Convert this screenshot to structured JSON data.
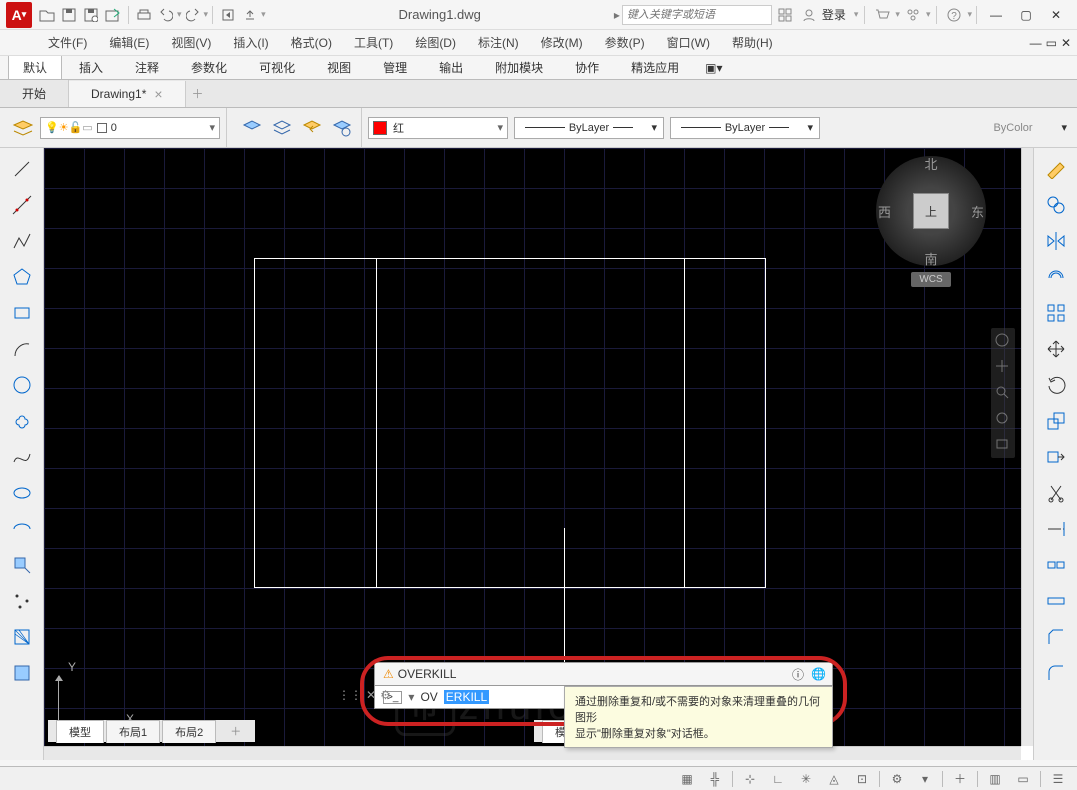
{
  "title": "Drawing1.dwg",
  "search_placeholder": "键入关键字或短语",
  "login_label": "登录",
  "menubar": [
    "文件(F)",
    "编辑(E)",
    "视图(V)",
    "插入(I)",
    "格式(O)",
    "工具(T)",
    "绘图(D)",
    "标注(N)",
    "修改(M)",
    "参数(P)",
    "窗口(W)",
    "帮助(H)"
  ],
  "ribbon_tabs": [
    "默认",
    "插入",
    "注释",
    "参数化",
    "可视化",
    "视图",
    "管理",
    "输出",
    "附加模块",
    "协作",
    "精选应用"
  ],
  "ribbon_active": 0,
  "doc_tabs": {
    "start": "开始",
    "drawing": "Drawing1*"
  },
  "layer": {
    "current": "0"
  },
  "color": {
    "label": "红",
    "hex": "#ff0000"
  },
  "linetype": "ByLayer",
  "lineweight": "ByLayer",
  "plotstyle": "ByColor",
  "viewcube": {
    "face": "上",
    "n": "北",
    "s": "南",
    "e": "东",
    "w": "西",
    "wcs": "WCS"
  },
  "ucs": {
    "x": "X",
    "y": "Y"
  },
  "command": {
    "history": "OVERKILL",
    "prompt_prefix": "OV",
    "prompt_highlight": "ERKILL",
    "tooltip_line1": "通过删除重复和/或不需要的对象来清理重叠的几何图形",
    "tooltip_line2": "显示\"删除重复对象\"对话框。"
  },
  "bottom_tabs": [
    "模型",
    "布局1",
    "布局2"
  ],
  "bottom_active": 0,
  "second_model_tab": "模型",
  "watermark": "zhulouren"
}
